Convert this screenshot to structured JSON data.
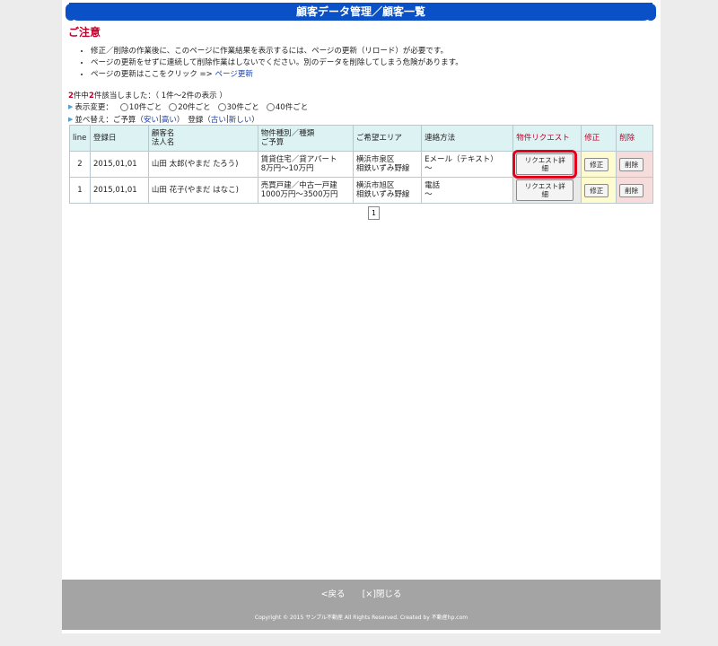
{
  "page_title": "顧客データ管理／顧客一覧",
  "caution": {
    "title": "ご注意",
    "notes": [
      "修正／削除の作業後に、このページに作業結果を表示するには、ページの更新（リロード）が必要です。",
      "ページの更新をせずに連続して削除作業はしないでください。別のデータを削除してしまう危険があります。",
      "ページの更新はここをクリック => "
    ],
    "refresh_link": "ページ更新"
  },
  "summary": {
    "total": "2",
    "mid": "件中",
    "match": "2",
    "tail": "件該当しました：（ 1件～2件の表示 ）"
  },
  "display_change": {
    "label": "表示変更：",
    "options": [
      "10件ごと",
      "20件ごと",
      "30件ごと",
      "40件ごと"
    ]
  },
  "sort": {
    "label": "並べ替え：",
    "budget": "ご予算（",
    "budget_low": "安い",
    "budget_high": "高い",
    "close_paren": "）",
    "registered": "登録（",
    "reg_old": "古い",
    "reg_new": "新しい",
    "sep": "|"
  },
  "table": {
    "headers": {
      "line": "line",
      "date": "登録日",
      "name": "顧客名",
      "name2": "法人名",
      "type": "物件種別／種類",
      "type2": "ご予算",
      "area": "ご希望エリア",
      "contact": "連絡方法",
      "request": "物件リクエスト",
      "edit": "修正",
      "delete": "削除"
    },
    "rows": [
      {
        "line": "2",
        "date": "2015,01,01",
        "name": "山田 太郎(やまだ たろう)",
        "type": "賃貸住宅／貸アパート",
        "budget": "8万円～10万円",
        "area": "横浜市泉区",
        "area2": "相鉄いずみ野線",
        "contact": "Eメール（テキスト）",
        "contact2": "～",
        "request_btn": "リクエスト詳細",
        "edit_btn": "修正",
        "delete_btn": "削除"
      },
      {
        "line": "1",
        "date": "2015,01,01",
        "name": "山田 花子(やまだ はなこ)",
        "type": "売買戸建／中古一戸建",
        "budget": "1000万円～3500万円",
        "area": "横浜市旭区",
        "area2": "相鉄いずみ野線",
        "contact": "電話",
        "contact2": "～",
        "request_btn": "リクエスト詳細",
        "edit_btn": "修正",
        "delete_btn": "削除"
      }
    ]
  },
  "pager": {
    "current": "1"
  },
  "footer": {
    "back": "<戻る",
    "close": "[×]閉じる",
    "copyright": "Copyright © 2015 サンプル不動産 All Rights Reserved. Created by 不動産hp.com"
  }
}
